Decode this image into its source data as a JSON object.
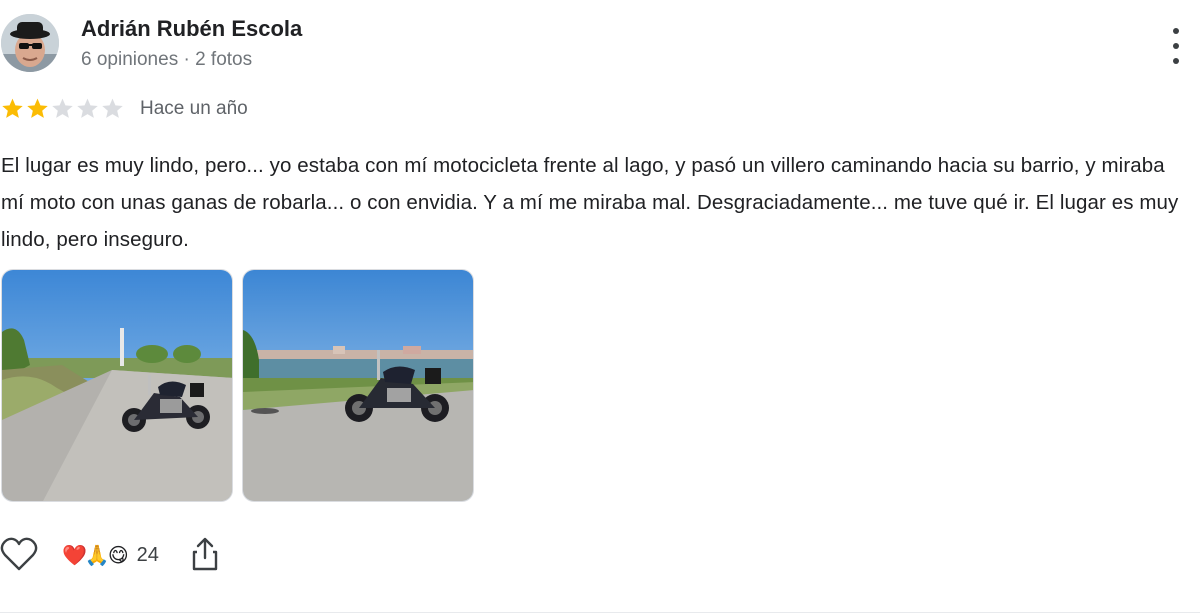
{
  "reviewer": {
    "name": "Adrián Rubén Escola",
    "stats": "6 opiniones · 2 fotos",
    "avatar_icon": "user-avatar"
  },
  "review": {
    "rating": 2,
    "max_rating": 5,
    "time": "Hace un año",
    "text": "El lugar es muy lindo, pero... yo estaba con mí motocicleta frente al lago, y pasó un villero caminando hacia su barrio, y miraba mí moto con unas ganas de robarla... o con envidia. Y a mí me miraba mal. Desgraciadamente... me tuve qué ir. El lugar es muy lindo, pero inseguro.",
    "photos": [
      {
        "icon": "motorcycle-photo-road"
      },
      {
        "icon": "motorcycle-photo-lake"
      }
    ]
  },
  "actions": {
    "like_icon": "heart-outline-icon",
    "reaction_emojis": [
      "❤️",
      "🙏",
      "😋"
    ],
    "reaction_count": "24",
    "share_icon": "share-icon",
    "more_icon": "more-vert-icon"
  },
  "colors": {
    "star_filled": "#fbbc04",
    "star_empty": "#dadce0",
    "text_primary": "#202124",
    "text_secondary": "#70757a"
  }
}
